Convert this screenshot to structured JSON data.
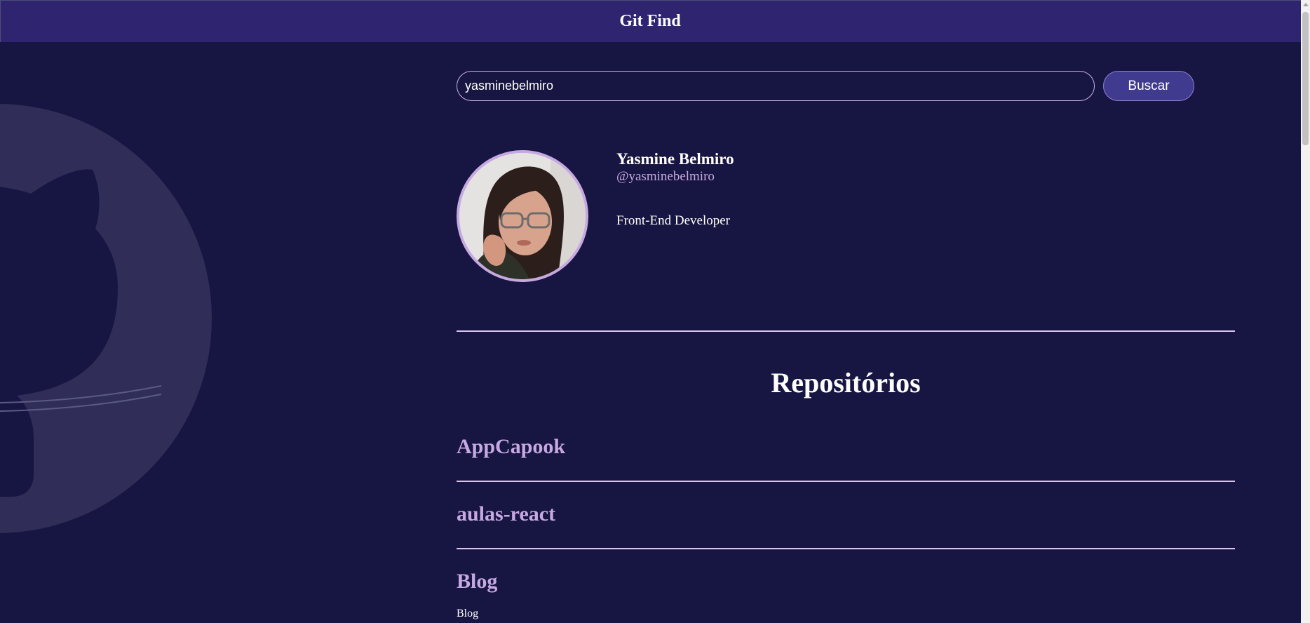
{
  "header": {
    "title": "Git Find"
  },
  "search": {
    "value": "yasminebelmiro",
    "button_label": "Buscar"
  },
  "profile": {
    "name": "Yasmine Belmiro",
    "login": "@yasminebelmiro",
    "bio": "Front-End Developer"
  },
  "repositories": {
    "title": "Repositórios",
    "items": [
      {
        "name": "AppCapook",
        "description": ""
      },
      {
        "name": "aulas-react",
        "description": ""
      },
      {
        "name": "Blog",
        "description": "Blog"
      }
    ]
  },
  "icons": {
    "background_logo": "github-octocat-icon",
    "avatar": "user-photo"
  },
  "colors": {
    "background": "#171541",
    "header": "#2e2470",
    "accent": "#c6a9e0",
    "button": "#413b8f"
  }
}
